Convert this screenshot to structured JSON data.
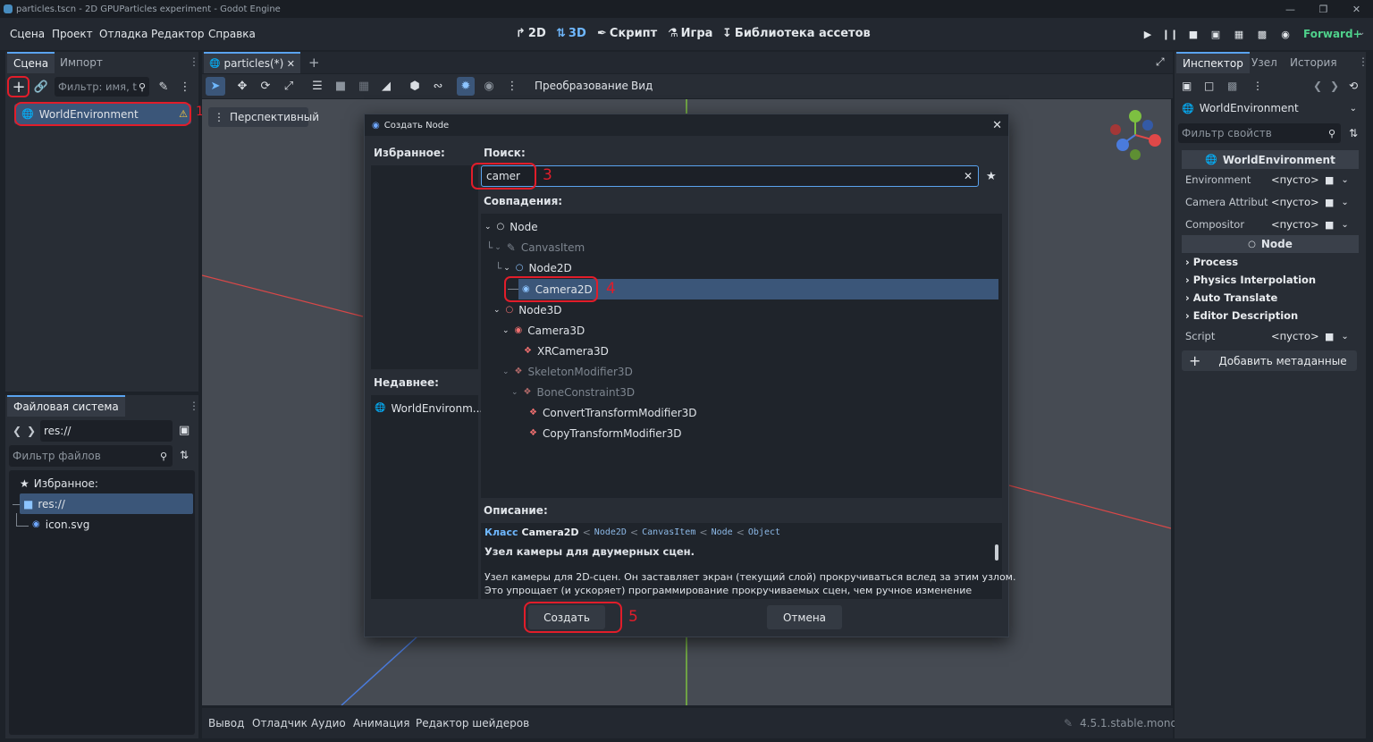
{
  "window": {
    "title": "particles.tscn - 2D GPUParticles experiment - Godot Engine"
  },
  "menu": [
    "Сцена",
    "Проект",
    "Отладка",
    "Редактор",
    "Справка"
  ],
  "workspaces": {
    "w2d": "2D",
    "w3d": "3D",
    "script": "Скрипт",
    "game": "Игра",
    "assetlib": "Библиотека ассетов"
  },
  "renderer": "Forward+",
  "scene_dock": {
    "tabs": [
      "Сцена",
      "Импорт"
    ],
    "filter_placeholder": "Фильтр: имя, t",
    "root_node": "WorldEnvironment",
    "marker_1": "1"
  },
  "filesystem": {
    "tab": "Файловая система",
    "path": "res://",
    "filter_placeholder": "Фильтр файлов",
    "favorites": "Избранное:",
    "root": "res://",
    "file": "icon.svg"
  },
  "editor": {
    "scene_tab": "particles(*)",
    "toolbar_transform": "Преобразование",
    "toolbar_view": "Вид",
    "perspective": "Перспективный"
  },
  "dialog": {
    "title": "Создать Node",
    "favorites": "Избранное:",
    "recent": "Недавнее:",
    "recent_item": "WorldEnvironm...",
    "search_label": "Поиск:",
    "search_value": "camer",
    "matches_label": "Совпадения:",
    "tree": [
      {
        "label": "Node"
      },
      {
        "label": "CanvasItem"
      },
      {
        "label": "Node2D"
      },
      {
        "label": "Camera2D"
      },
      {
        "label": "Node3D"
      },
      {
        "label": "Camera3D"
      },
      {
        "label": "XRCamera3D"
      },
      {
        "label": "SkeletonModifier3D"
      },
      {
        "label": "BoneConstraint3D"
      },
      {
        "label": "ConvertTransformModifier3D"
      },
      {
        "label": "CopyTransformModifier3D"
      }
    ],
    "desc_label": "Описание:",
    "desc_class_word": "Класс",
    "desc_class": "Camera2D",
    "desc_hierarchy": [
      "Node2D",
      "CanvasItem",
      "Node",
      "Object"
    ],
    "desc_brief": "Узел камеры для двумерных сцен.",
    "desc_body_1": "Узел камеры для 2D-сцен. Он заставляет экран (текущий слой) прокручиваться вслед за этим узлом.",
    "desc_body_2": "Это упрощает (и ускоряет) программирование прокручиваемых сцен, чем ручное изменение",
    "create_button": "Создать",
    "cancel_button": "Отмена",
    "marker_3": "3",
    "marker_4": "4",
    "marker_5": "5"
  },
  "inspector": {
    "tabs": [
      "Инспектор",
      "Узел",
      "История"
    ],
    "node_name": "WorldEnvironment",
    "filter_placeholder": "Фильтр свойств",
    "header": "WorldEnvironment",
    "props": [
      {
        "key": "Environment",
        "value": "<пусто>"
      },
      {
        "key": "Camera Attribut",
        "value": "<пусто>"
      },
      {
        "key": "Compositor",
        "value": "<пусто>"
      }
    ],
    "node_header": "Node",
    "sections": [
      "Process",
      "Physics Interpolation",
      "Auto Translate",
      "Editor Description"
    ],
    "script_key": "Script",
    "script_value": "<пусто>",
    "add_meta": "Добавить метаданные"
  },
  "bottom_panel": {
    "tabs": [
      "Вывод",
      "Отладчик",
      "Аудио",
      "Анимация",
      "Редактор шейдеров"
    ],
    "version": "4.5.1.stable.mono"
  },
  "colors": {
    "accent": "#5aa3ef",
    "annotation": "#e11d2a",
    "renderer": "#4fd18b"
  }
}
